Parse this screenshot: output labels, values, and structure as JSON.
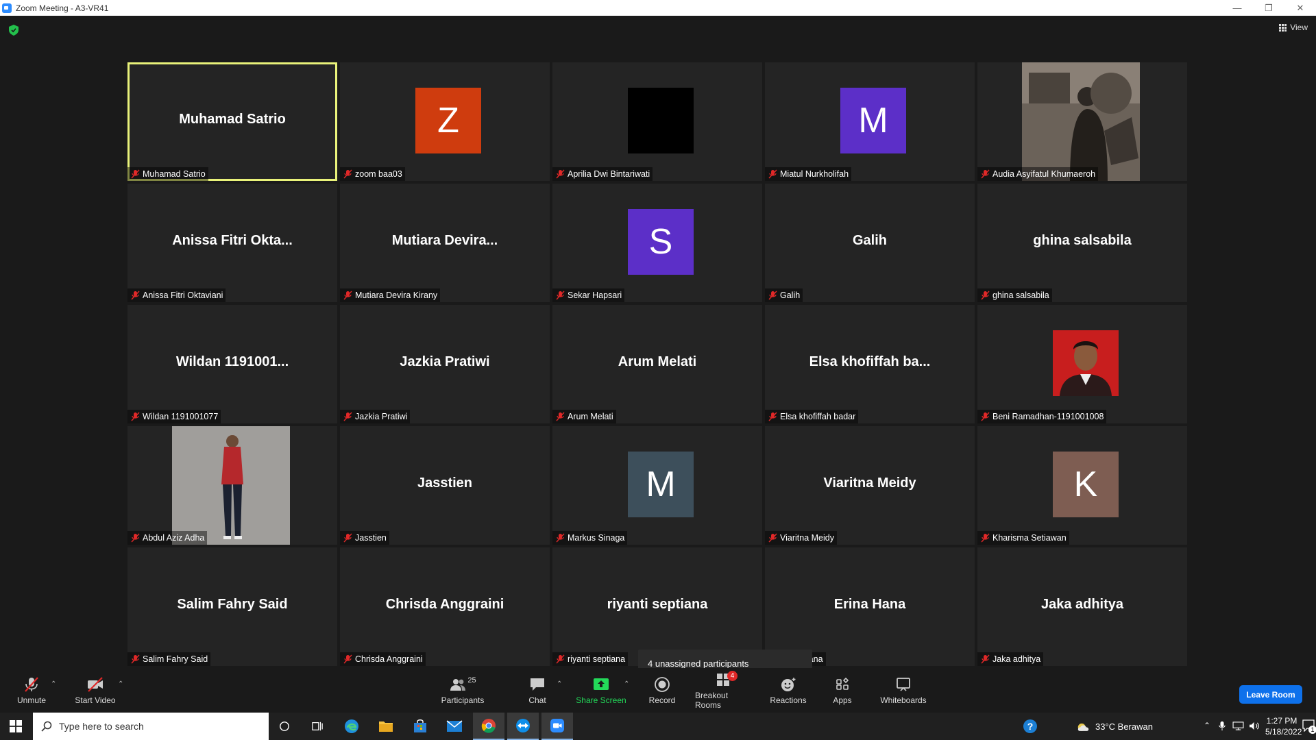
{
  "window": {
    "title": "Zoom Meeting - A3-VR41"
  },
  "header": {
    "view_label": "View"
  },
  "tiles": [
    {
      "big": "Muhamad Satrio",
      "caption": "Muhamad Satrio",
      "active": true
    },
    {
      "avatar": "Z",
      "color": "#cf3c0e",
      "caption": "zoom baa03"
    },
    {
      "avatar": "",
      "color": "#000000",
      "caption": "Aprilia Dwi Bintariwati"
    },
    {
      "avatar": "M",
      "color": "#5c2fc8",
      "caption": "Miatul Nurkholifah"
    },
    {
      "photo": "photo-sepia",
      "caption": "Audia Asyifatul Khumaeroh"
    },
    {
      "big": "Anissa Fitri Okta...",
      "caption": "Anissa Fitri Oktaviani"
    },
    {
      "big": "Mutiara Devira...",
      "caption": "Mutiara Devira Kirany"
    },
    {
      "avatar": "S",
      "color": "#5c2fc8",
      "caption": "Sekar Hapsari"
    },
    {
      "big": "Galih",
      "caption": "Galih"
    },
    {
      "big": "ghina salsabila",
      "caption": "ghina salsabila"
    },
    {
      "big": "Wildan 1191001...",
      "caption": "Wildan 1191001077"
    },
    {
      "big": "Jazkia Pratiwi",
      "caption": "Jazkia Pratiwi"
    },
    {
      "big": "Arum Melati",
      "caption": "Arum Melati"
    },
    {
      "big": "Elsa khofiffah ba...",
      "caption": "Elsa khofiffah badar"
    },
    {
      "photo": "photo-red",
      "caption": "Beni Ramadhan-1191001008"
    },
    {
      "photo": "photo-standing",
      "caption": "Abdul Aziz Adha"
    },
    {
      "big": "Jasstien",
      "caption": "Jasstien"
    },
    {
      "avatar": "M",
      "color": "#3d4f5b",
      "caption": "Markus Sinaga"
    },
    {
      "big": "Viaritna Meidy",
      "caption": "Viaritna Meidy"
    },
    {
      "avatar": "K",
      "color": "#7e5d52",
      "caption": "Kharisma Setiawan"
    },
    {
      "big": "Salim Fahry Said",
      "caption": "Salim Fahry Said"
    },
    {
      "big": "Chrisda Anggraini",
      "caption": "Chrisda Anggraini"
    },
    {
      "big": "riyanti septiana",
      "caption": "riyanti septiana"
    },
    {
      "big": "Erina Hana",
      "caption": "Erina Hana"
    },
    {
      "big": "Jaka adhitya",
      "caption": "Jaka adhitya"
    }
  ],
  "tooltip": {
    "text": "4 unassigned participants"
  },
  "toolbar": {
    "unmute": "Unmute",
    "start_video": "Start Video",
    "participants": "Participants",
    "participants_count": "25",
    "chat": "Chat",
    "share_screen": "Share Screen",
    "record": "Record",
    "breakout_rooms": "Breakout Rooms",
    "breakout_badge": "4",
    "reactions": "Reactions",
    "apps": "Apps",
    "whiteboards": "Whiteboards",
    "leave": "Leave Room"
  },
  "taskbar": {
    "search_placeholder": "Type here to search",
    "weather": "33°C  Berawan",
    "time": "1:27 PM",
    "date": "5/18/2022",
    "notifications": "1"
  },
  "colors": {
    "accent": "#0e71eb",
    "active_speaker": "#e9f27a",
    "share_green": "#23d959",
    "mute_red": "#e02828"
  }
}
